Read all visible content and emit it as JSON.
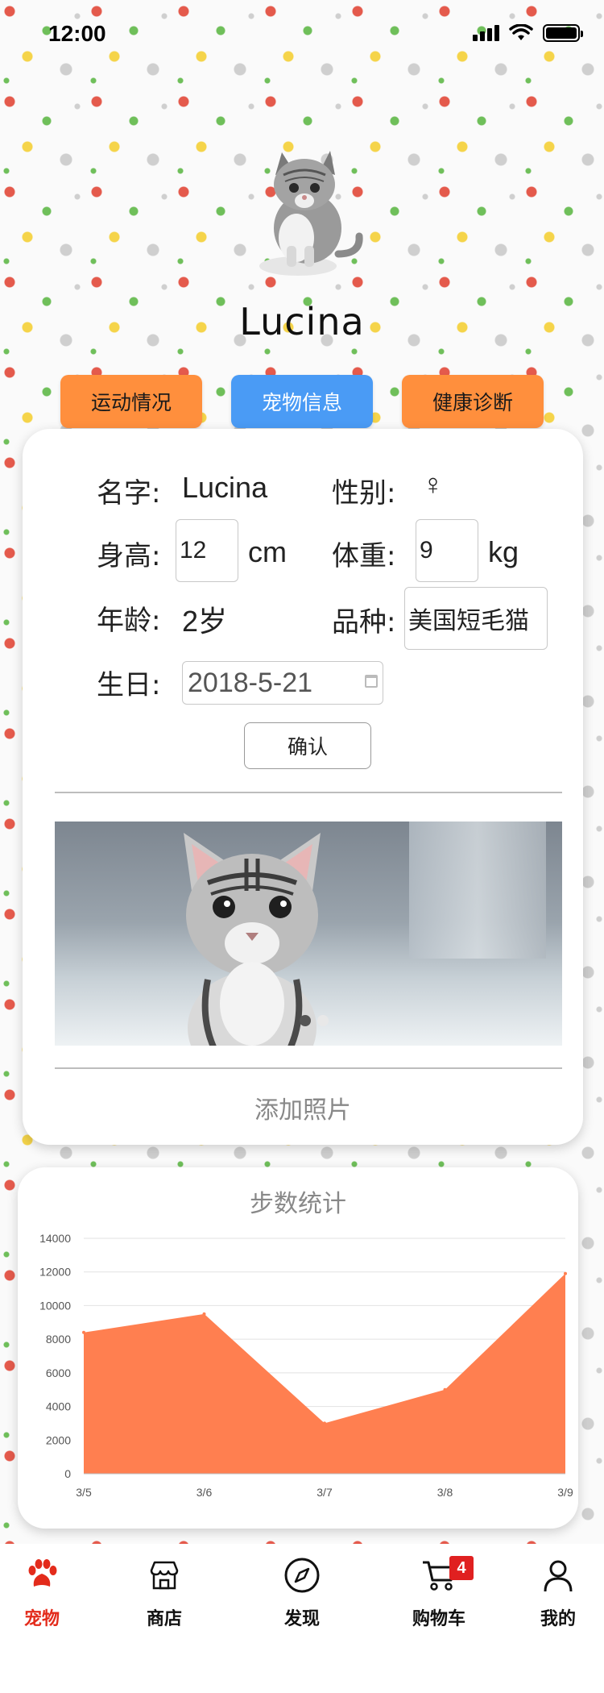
{
  "status_bar": {
    "time": "12:00"
  },
  "pet": {
    "name": "Lucina"
  },
  "tabs": [
    {
      "label": "运动情况",
      "active": false
    },
    {
      "label": "宠物信息",
      "active": true
    },
    {
      "label": "健康诊断",
      "active": false
    }
  ],
  "info": {
    "name_label": "名字:",
    "name_value": "Lucina",
    "gender_label": "性别:",
    "gender_value": "♀",
    "height_label": "身高:",
    "height_value": "12",
    "height_unit": "cm",
    "weight_label": "体重:",
    "weight_value": "9",
    "weight_unit": "kg",
    "age_label": "年龄:",
    "age_value": "2岁",
    "breed_label": "品种:",
    "breed_value": "美国短毛猫",
    "birthday_label": "生日:",
    "birthday_value": "2018-5-21",
    "confirm_label": "确认"
  },
  "photos": {
    "count": 2,
    "active_index": 1,
    "add_label": "添加照片"
  },
  "chart_data": {
    "type": "area",
    "title": "步数统计",
    "categories": [
      "3/5",
      "3/6",
      "3/7",
      "3/8",
      "3/9"
    ],
    "values": [
      8400,
      9500,
      3000,
      5000,
      11900
    ],
    "ylim": [
      0,
      14000
    ],
    "yticks": [
      "0",
      "2000",
      "4000",
      "6000",
      "8000",
      "10000",
      "12000",
      "14000"
    ],
    "color": "#ff7f50",
    "grid": true
  },
  "nav": {
    "items": [
      {
        "label": "宠物",
        "icon": "paw-icon",
        "active": true
      },
      {
        "label": "商店",
        "icon": "store-icon",
        "active": false
      },
      {
        "label": "发现",
        "icon": "compass-icon",
        "active": false
      },
      {
        "label": "购物车",
        "icon": "cart-icon",
        "active": false,
        "badge": "4"
      },
      {
        "label": "我的",
        "icon": "user-icon",
        "active": false
      }
    ]
  },
  "colors": {
    "accent_orange": "#ff8f3d",
    "accent_blue": "#4a9bf5",
    "active_red": "#e32b1b"
  }
}
